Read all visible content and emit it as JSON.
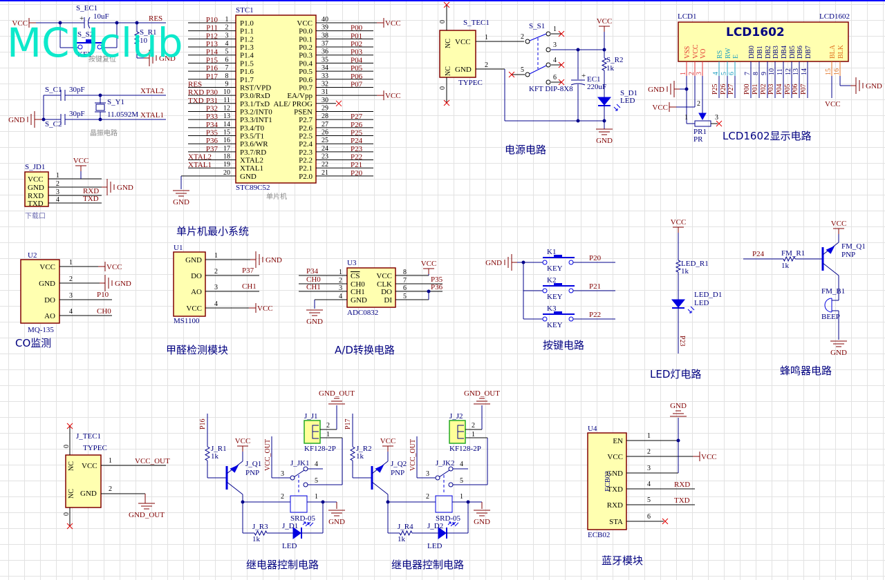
{
  "watermark": "MCUclub",
  "nets": {
    "vcc": "VCC",
    "gnd": "GND",
    "vcc_out": "VCC_OUT",
    "gnd_out": "GND_OUT",
    "res": "RES",
    "xtal1": "XTAL1",
    "xtal2": "XTAL2",
    "rxd": "RXD",
    "txd": "TXD",
    "ch0": "CH0",
    "ch1": "CH1",
    "plus": "+"
  },
  "reset": {
    "cap_ref": "S_EC1",
    "cap_val": "10uF",
    "sw_ref": "S_S2",
    "sw_val": "KEY",
    "res_ref": "S_R1",
    "res_val": "10",
    "caption": "按键复位"
  },
  "crystal": {
    "c1_ref": "S_C1",
    "c1_val": "30pF",
    "c2_ref": "S_C2",
    "c2_val": "30pF",
    "y_ref": "S_Y1",
    "y_val": "11.0592M",
    "caption": "晶振电路"
  },
  "download": {
    "ref": "S_JD1",
    "caption": "下载口",
    "pins": [
      {
        "num": "1",
        "name": "VCC"
      },
      {
        "num": "2",
        "name": "GND"
      },
      {
        "num": "3",
        "name": "RXD"
      },
      {
        "num": "4",
        "name": "TXD"
      }
    ]
  },
  "mcu": {
    "ref": "STC1",
    "part": "STC89C52",
    "caption": "单片机",
    "title": "单片机最小系统",
    "left_pins": [
      {
        "num": "1",
        "name": "P1.0",
        "net": "P10",
        "alias": ""
      },
      {
        "num": "2",
        "name": "P1.1",
        "net": "P11",
        "alias": ""
      },
      {
        "num": "3",
        "name": "P1.2",
        "net": "P12",
        "alias": ""
      },
      {
        "num": "4",
        "name": "P1.3",
        "net": "P13",
        "alias": ""
      },
      {
        "num": "5",
        "name": "P1.4",
        "net": "P14",
        "alias": ""
      },
      {
        "num": "6",
        "name": "P1.5",
        "net": "P15",
        "alias": ""
      },
      {
        "num": "7",
        "name": "P1.6",
        "net": "P16",
        "alias": ""
      },
      {
        "num": "8",
        "name": "P1.7",
        "net": "P17",
        "alias": ""
      },
      {
        "num": "9",
        "name": "RST/VPD",
        "net": "",
        "alias": "RES"
      },
      {
        "num": "10",
        "name": "P3.0/RxD",
        "net": "P30",
        "alias": "RXD"
      },
      {
        "num": "11",
        "name": "P3.1/TxD",
        "net": "P31",
        "alias": "TXD"
      },
      {
        "num": "12",
        "name": "P3.2/INT0",
        "net": "P32",
        "alias": ""
      },
      {
        "num": "13",
        "name": "P3.3/INT1",
        "net": "P33",
        "alias": ""
      },
      {
        "num": "14",
        "name": "P3.4/T0",
        "net": "P34",
        "alias": ""
      },
      {
        "num": "15",
        "name": "P3.5/T1",
        "net": "P35",
        "alias": ""
      },
      {
        "num": "16",
        "name": "P3.6/WR",
        "net": "P36",
        "alias": ""
      },
      {
        "num": "17",
        "name": "P3.7/RD",
        "net": "P37",
        "alias": ""
      },
      {
        "num": "18",
        "name": "XTAL2",
        "net": "",
        "alias": "XTAL2"
      },
      {
        "num": "19",
        "name": "XTAL1",
        "net": "",
        "alias": "XTAL1"
      },
      {
        "num": "20",
        "name": "GND",
        "net": "",
        "alias": ""
      }
    ],
    "right_pins": [
      {
        "num": "40",
        "name": "VCC",
        "net": "VCC"
      },
      {
        "num": "39",
        "name": "P0.0",
        "net": "P00"
      },
      {
        "num": "38",
        "name": "P0.1",
        "net": "P01"
      },
      {
        "num": "37",
        "name": "P0.2",
        "net": "P02"
      },
      {
        "num": "36",
        "name": "P0.3",
        "net": "P03"
      },
      {
        "num": "35",
        "name": "P0.4",
        "net": "P04"
      },
      {
        "num": "34",
        "name": "P0.5",
        "net": "P05"
      },
      {
        "num": "33",
        "name": "P0.6",
        "net": "P06"
      },
      {
        "num": "32",
        "name": "P0.7",
        "net": "P07"
      },
      {
        "num": "31",
        "name": "EA/Vpp",
        "net": "VCC"
      },
      {
        "num": "30",
        "name": "ALE/ PROG",
        "net": ""
      },
      {
        "num": "29",
        "name": "PSEN",
        "net": ""
      },
      {
        "num": "28",
        "name": "P2.7",
        "net": "P27"
      },
      {
        "num": "27",
        "name": "P2.6",
        "net": "P26"
      },
      {
        "num": "26",
        "name": "P2.5",
        "net": "P25"
      },
      {
        "num": "25",
        "name": "P2.4",
        "net": "P24"
      },
      {
        "num": "24",
        "name": "P2.3",
        "net": "P23"
      },
      {
        "num": "23",
        "name": "P2.2",
        "net": "P22"
      },
      {
        "num": "22",
        "name": "P2.1",
        "net": "P21"
      },
      {
        "num": "21",
        "name": "P2.0",
        "net": "P20"
      }
    ]
  },
  "power": {
    "conn_ref": "S_TEC1",
    "conn_part": "TYPEC",
    "nc": "NC",
    "zero": "0",
    "conn_pins": [
      {
        "num": "1",
        "name": "VCC"
      },
      {
        "num": "2",
        "name": "GND"
      }
    ],
    "sw_ref": "S_S1",
    "sw_part": "KFT DIP-8X8",
    "sw_pins": [
      "1",
      "2",
      "3",
      "4",
      "5",
      "6"
    ],
    "cap_ref": "EC1",
    "cap_val": "220uF",
    "res_ref": "S_R2",
    "res_val": "1k",
    "led_ref": "S_D1",
    "led_val": "LED",
    "title": "电源电路"
  },
  "lcd": {
    "ref": "LCD1",
    "part": "LCD1602",
    "body": "LCD1602",
    "title": "LCD1602显示电路",
    "pins": [
      {
        "num": "1",
        "name": "VSS",
        "net": ""
      },
      {
        "num": "2",
        "name": "VCC",
        "net": ""
      },
      {
        "num": "3",
        "name": "VO",
        "net": ""
      },
      {
        "num": "4",
        "name": "RS",
        "net": "P25"
      },
      {
        "num": "5",
        "name": "RW",
        "net": "P26"
      },
      {
        "num": "6",
        "name": "E",
        "net": "P27"
      },
      {
        "num": "7",
        "name": "DB0",
        "net": "P00"
      },
      {
        "num": "8",
        "name": "DB1",
        "net": "P01"
      },
      {
        "num": "9",
        "name": "DB2",
        "net": "P02"
      },
      {
        "num": "10",
        "name": "DB3",
        "net": "P03"
      },
      {
        "num": "11",
        "name": "DB4",
        "net": "P04"
      },
      {
        "num": "12",
        "name": "DB5",
        "net": "P05"
      },
      {
        "num": "13",
        "name": "DB6",
        "net": "P06"
      },
      {
        "num": "14",
        "name": "DB7",
        "net": "P07"
      },
      {
        "num": "15",
        "name": "BLA",
        "net": ""
      },
      {
        "num": "16",
        "name": "BLK",
        "net": ""
      }
    ],
    "pot_ref": "PR1",
    "pot_val": "PR",
    "pot_pins": [
      "1",
      "2",
      "3"
    ]
  },
  "co": {
    "ref": "U2",
    "part": "MQ-135",
    "title": "CO监测",
    "pins": [
      {
        "num": "1",
        "name": "VCC",
        "net": "VCC"
      },
      {
        "num": "2",
        "name": "GND",
        "net": "GND"
      },
      {
        "num": "3",
        "name": "DO",
        "net": "P10"
      },
      {
        "num": "4",
        "name": "AO",
        "net": "CH0"
      }
    ]
  },
  "hcho": {
    "ref": "U1",
    "part": "MS1100",
    "title": "甲醛检测模块",
    "pins": [
      {
        "num": "1",
        "name": "GND",
        "net": "GND"
      },
      {
        "num": "2",
        "name": "DO",
        "net": "P37"
      },
      {
        "num": "3",
        "name": "AO",
        "net": "CH1"
      },
      {
        "num": "4",
        "name": "VCC",
        "net": "VCC"
      }
    ]
  },
  "adc": {
    "ref": "U3",
    "part": "ADC0832",
    "title": "A/D转换电路",
    "left_pins": [
      {
        "num": "1",
        "name": "CS",
        "net": "P34"
      },
      {
        "num": "2",
        "name": "CH0",
        "net": "CH0"
      },
      {
        "num": "3",
        "name": "CH1",
        "net": "CH1"
      },
      {
        "num": "4",
        "name": "GND",
        "net": "GND"
      }
    ],
    "right_pins": [
      {
        "num": "8",
        "name": "VCC",
        "net": "VCC"
      },
      {
        "num": "7",
        "name": "CLK",
        "net": "P35"
      },
      {
        "num": "6",
        "name": "DO",
        "net": "P36"
      },
      {
        "num": "5",
        "name": "DI",
        "net": ""
      }
    ]
  },
  "keys": {
    "title": "按键电路",
    "items": [
      {
        "ref": "K1",
        "val": "KEY",
        "net": "P20"
      },
      {
        "ref": "K2",
        "val": "KEY",
        "net": "P21"
      },
      {
        "ref": "K3",
        "val": "KEY",
        "net": "P22"
      }
    ]
  },
  "led": {
    "res_ref": "LED_R1",
    "res_val": "1k",
    "led_ref": "LED_D1",
    "led_val": "LED",
    "net": "P23",
    "title": "LED灯电路"
  },
  "buzzer": {
    "net": "P24",
    "res_ref": "FM_R1",
    "res_val": "1k",
    "q_ref": "FM_Q1",
    "q_val": "PNP",
    "b_ref": "FM_B1",
    "b_val": "BEEP",
    "title": "蜂鸣器电路"
  },
  "typec_out": {
    "ref": "J_TEC1",
    "part": "TYPEC",
    "nc": "NC",
    "zero": "0",
    "pins": [
      {
        "num": "1",
        "name": "VCC"
      },
      {
        "num": "2",
        "name": "GND"
      }
    ]
  },
  "relays": [
    {
      "in": "P16",
      "r1_ref": "J_R1",
      "r1_val": "1k",
      "q_ref": "J_Q1",
      "q_val": "PNP",
      "k_ref": "J_JK1",
      "k_val": "SRD-05",
      "j_ref": "J_J1",
      "j_val": "KF128-2P",
      "r2_ref": "J_R3",
      "r2_val": "1k",
      "d_ref": "J_D1",
      "d_val": "LED",
      "pins": [
        "1",
        "2",
        "3",
        "4",
        "5"
      ],
      "title": "继电器控制电路"
    },
    {
      "in": "P17",
      "r1_ref": "J_R2",
      "r1_val": "1k",
      "q_ref": "J_Q2",
      "q_val": "PNP",
      "k_ref": "J_JK2",
      "k_val": "SRD-05",
      "j_ref": "J_J2",
      "j_val": "KF128-2P",
      "r2_ref": "J_R4",
      "r2_val": "1k",
      "d_ref": "J_D2",
      "d_val": "LED",
      "pins": [
        "1",
        "2",
        "3",
        "4",
        "5"
      ],
      "title": "继电器控制电路"
    }
  ],
  "bluetooth": {
    "ref": "U4",
    "part": "ECB02",
    "body": "ECB02",
    "title": "蓝牙模块",
    "pins": [
      {
        "num": "1",
        "name": "EN",
        "net": ""
      },
      {
        "num": "2",
        "name": "VCC",
        "net": "VCC"
      },
      {
        "num": "3",
        "name": "GND",
        "net": ""
      },
      {
        "num": "4",
        "name": "TXD",
        "net": "RXD"
      },
      {
        "num": "5",
        "name": "RXD",
        "net": "TXD"
      },
      {
        "num": "6",
        "name": "STA",
        "net": ""
      }
    ]
  },
  "colors": {
    "wire": "#00008b",
    "net_label": "#800000",
    "designator": "#000080",
    "body_fill": "#ffffb0",
    "watermark": "#00e8c8"
  }
}
